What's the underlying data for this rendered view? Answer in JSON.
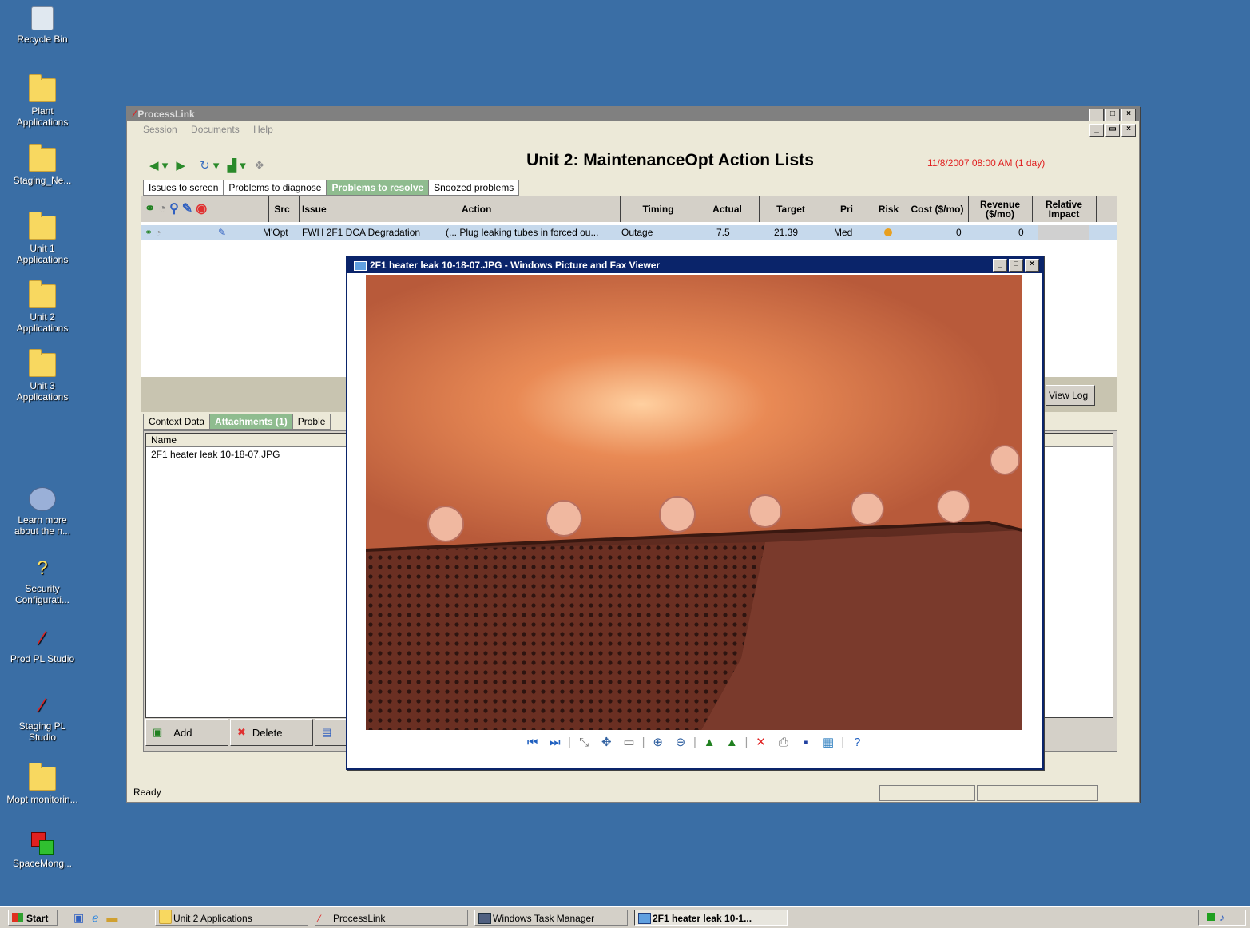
{
  "desktop": {
    "icons": [
      {
        "label": "Recycle Bin",
        "icon": "recycle-bin-icon"
      },
      {
        "label": "Plant Applications",
        "icon": "folder-icon"
      },
      {
        "label": "Staging_Ne...",
        "icon": "folder-icon"
      },
      {
        "label": "Unit 1 Applications",
        "icon": "folder-icon"
      },
      {
        "label": "Unit 2 Applications",
        "icon": "folder-icon"
      },
      {
        "label": "Unit 3 Applications",
        "icon": "folder-icon"
      },
      {
        "label": "Learn more about the n...",
        "icon": "learn-icon"
      },
      {
        "label": "Security Configurati...",
        "icon": "security-icon"
      },
      {
        "label": "Prod PL Studio",
        "icon": "pl-studio-icon"
      },
      {
        "label": "Staging PL Studio",
        "icon": "pl-studio-icon"
      },
      {
        "label": "Mopt monitorin...",
        "icon": "folder-icon"
      },
      {
        "label": "SpaceMong...",
        "icon": "spacemonger-icon"
      }
    ]
  },
  "processlink": {
    "title": "ProcessLink",
    "menu": [
      "Session",
      "Documents",
      "Help"
    ],
    "heading": "Unit 2: MaintenanceOpt Action Lists",
    "timestamp": "11/8/2007 08:00 AM (1 day)",
    "tabs": [
      "Issues to screen",
      "Problems to diagnose",
      "Problems to resolve",
      "Snoozed problems"
    ],
    "columns": {
      "src": "Src",
      "issue": "Issue",
      "action": "Action",
      "timing": "Timing",
      "actual": "Actual",
      "target": "Target",
      "pri": "Pri",
      "risk": "Risk",
      "cost": "Cost ($/mo)",
      "revenue": "Revenue ($/mo)",
      "impact": "Relative Impact"
    },
    "row": {
      "src": "M'Opt",
      "issue": "FWH 2F1 DCA Degradation",
      "action": "(... Plug leaking tubes in forced ou...",
      "timing": "Outage",
      "actual": "7.5",
      "target": "21.39",
      "pri": "Med",
      "cost": "0",
      "revenue": "0",
      "risk_color": "#e8a020"
    },
    "view_log": "View Log",
    "lower_tabs": [
      "Context Data",
      "Attachments (1)",
      "Proble"
    ],
    "attach_header": "Name",
    "attachment": "2F1 heater leak 10-18-07.JPG",
    "add_label": "Add",
    "delete_label": "Delete",
    "status": "Ready"
  },
  "viewer": {
    "title": "2F1 heater leak 10-18-07.JPG - Windows Picture and Fax Viewer",
    "toolbar_icons": [
      "previous-icon",
      "next-icon",
      "best-fit-icon",
      "actual-size-icon",
      "slideshow-icon",
      "zoom-in-icon",
      "zoom-out-icon",
      "rotate-clockwise-icon",
      "rotate-counterclockwise-icon",
      "delete-icon",
      "print-icon",
      "save-icon",
      "open-editor-icon",
      "help-icon"
    ]
  },
  "taskbar": {
    "start": "Start",
    "items": [
      "Unit 2 Applications",
      "ProcessLink",
      "Windows Task Manager",
      "2F1 heater leak 10-1..."
    ]
  }
}
